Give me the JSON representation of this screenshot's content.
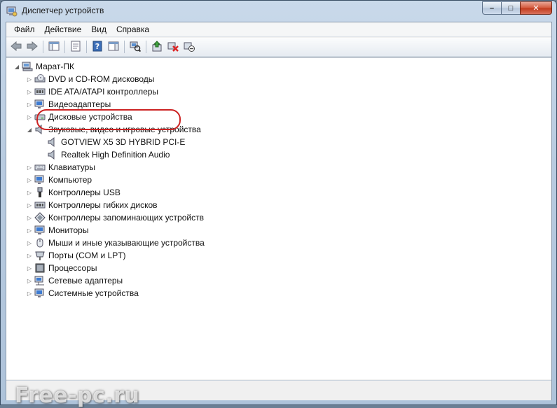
{
  "window": {
    "title": "Диспетчер устройств",
    "caption_buttons": {
      "minimize": "–",
      "maximize": "□",
      "close": "✕"
    }
  },
  "menubar": {
    "items": [
      "Файл",
      "Действие",
      "Вид",
      "Справка"
    ]
  },
  "toolbar": {
    "buttons": [
      "back-icon",
      "forward-icon",
      "show-hide-console-tree-icon",
      "properties-icon",
      "help-icon",
      "action-pane-icon",
      "scan-hardware-icon",
      "update-driver-icon",
      "uninstall-icon",
      "disable-icon"
    ]
  },
  "tree": {
    "root": {
      "label": "Марат-ПК",
      "icon": "computer-icon",
      "state": "expanded"
    },
    "categories": [
      {
        "label": "DVD и CD-ROM дисководы",
        "icon": "dvd-drive-icon",
        "state": "collapsed"
      },
      {
        "label": "IDE ATA/ATAPI контроллеры",
        "icon": "ide-controller-icon",
        "state": "collapsed"
      },
      {
        "label": "Видеоадаптеры",
        "icon": "display-adapter-icon",
        "state": "collapsed"
      },
      {
        "label": "Дисковые устройства",
        "icon": "disk-drive-icon",
        "state": "collapsed"
      },
      {
        "label": "Звуковые, видео и игровые устройства",
        "icon": "speaker-icon",
        "state": "expanded"
      },
      {
        "label": "Клавиатуры",
        "icon": "keyboard-icon",
        "state": "collapsed"
      },
      {
        "label": "Компьютер",
        "icon": "monitor-icon",
        "state": "collapsed"
      },
      {
        "label": "Контроллеры USB",
        "icon": "usb-icon",
        "state": "collapsed"
      },
      {
        "label": "Контроллеры гибких дисков",
        "icon": "floppy-controller-icon",
        "state": "collapsed"
      },
      {
        "label": "Контроллеры запоминающих устройств",
        "icon": "storage-controller-icon",
        "state": "collapsed"
      },
      {
        "label": "Мониторы",
        "icon": "monitor-icon",
        "state": "collapsed"
      },
      {
        "label": "Мыши и иные указывающие устройства",
        "icon": "mouse-icon",
        "state": "collapsed"
      },
      {
        "label": "Порты (COM и LPT)",
        "icon": "port-icon",
        "state": "collapsed"
      },
      {
        "label": "Процессоры",
        "icon": "processor-icon",
        "state": "collapsed"
      },
      {
        "label": "Сетевые адаптеры",
        "icon": "network-adapter-icon",
        "state": "collapsed"
      },
      {
        "label": "Системные устройства",
        "icon": "system-device-icon",
        "state": "collapsed"
      }
    ],
    "sound_children": [
      {
        "label": "GOTVIEW X5 3D HYBRID PCI-E",
        "icon": "speaker-icon",
        "highlighted": true
      },
      {
        "label": "Realtek High Definition Audio",
        "icon": "speaker-icon"
      }
    ]
  },
  "watermark": "Free-pc.ru",
  "colors": {
    "highlight_ring": "#cc2222",
    "window_frame": "#b8cbe0"
  }
}
